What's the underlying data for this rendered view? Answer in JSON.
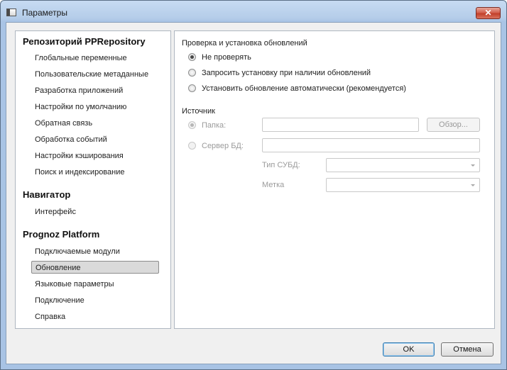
{
  "window": {
    "title": "Параметры",
    "close_symbol": "✕"
  },
  "nav": {
    "sections": [
      {
        "title": "Репозиторий PPRepository",
        "items": [
          "Глобальные переменные",
          "Пользовательские метаданные",
          "Разработка приложений",
          "Настройки по умолчанию",
          "Обратная связь",
          "Обработка событий",
          "Настройки кэширования",
          "Поиск и индексирование"
        ]
      },
      {
        "title": "Навигатор",
        "items": [
          "Интерфейс"
        ]
      },
      {
        "title": "Prognoz Platform",
        "items": [
          "Подключаемые модули",
          "Обновление",
          "Языковые параметры",
          "Подключение",
          "Справка"
        ]
      }
    ],
    "selected_item": "Обновление"
  },
  "updates": {
    "group_title": "Проверка и установка обновлений",
    "options": [
      "Не проверять",
      "Запросить установку при наличии обновлений",
      "Установить обновление автоматически (рекомендуется)"
    ],
    "selected_option": "Не проверять"
  },
  "source": {
    "group_title": "Источник",
    "folder_label": "Папка:",
    "folder_value": "",
    "browse_label": "Обзор...",
    "db_server_label": "Сервер БД:",
    "db_server_value": "",
    "dbms_type_label": "Тип СУБД:",
    "dbms_type_value": "",
    "tag_label": "Метка",
    "tag_value": "",
    "selected_source": "Папка:",
    "enabled": false
  },
  "buttons": {
    "ok": "OK",
    "cancel": "Отмена"
  }
}
